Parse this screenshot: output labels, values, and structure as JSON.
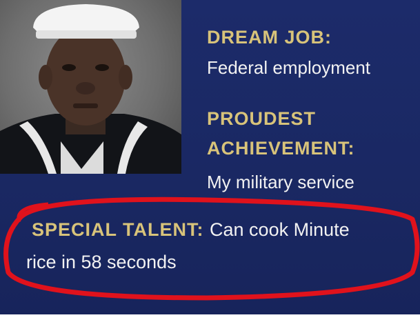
{
  "dream_job": {
    "label": "DREAM JOB:",
    "value": "Federal employment"
  },
  "proudest_achievement": {
    "label_line1": "PROUDEST",
    "label_line2": "ACHIEVEMENT:",
    "value": "My military service"
  },
  "special_talent": {
    "label": "SPECIAL TALENT:",
    "value_line1": "Can cook Minute",
    "value_line2": "rice in 58 seconds"
  },
  "colors": {
    "background": "#1c2b6a",
    "label": "#d8c37a",
    "text": "#f2f2f2",
    "highlight_circle": "#e0121c"
  }
}
